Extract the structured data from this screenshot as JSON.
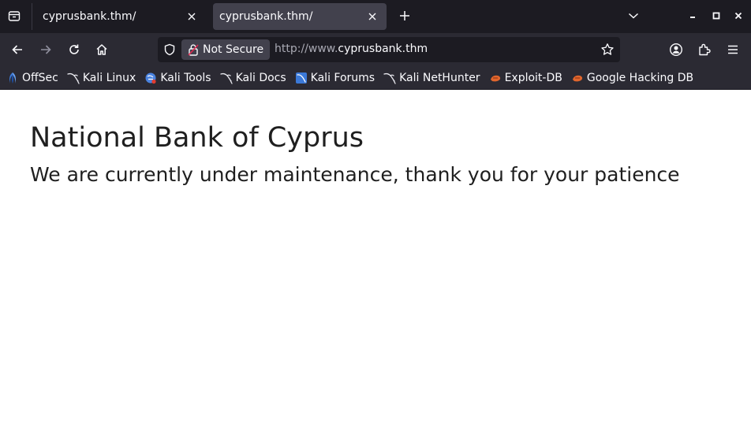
{
  "tabs": [
    {
      "title": "cyprusbank.thm/",
      "active": false
    },
    {
      "title": "cyprusbank.thm/",
      "active": true
    }
  ],
  "urlbar": {
    "security_label": "Not Secure",
    "url_prefix": "http://www.",
    "url_host": "cyprusbank.thm"
  },
  "bookmarks": [
    {
      "label": "OffSec",
      "icon": "offsec-icon"
    },
    {
      "label": "Kali Linux",
      "icon": "kali-dragon-icon"
    },
    {
      "label": "Kali Tools",
      "icon": "kali-tools-icon"
    },
    {
      "label": "Kali Docs",
      "icon": "kali-dragon-icon"
    },
    {
      "label": "Kali Forums",
      "icon": "kali-forums-icon"
    },
    {
      "label": "Kali NetHunter",
      "icon": "kali-dragon-icon"
    },
    {
      "label": "Exploit-DB",
      "icon": "exploit-db-icon"
    },
    {
      "label": "Google Hacking DB",
      "icon": "exploit-db-icon"
    }
  ],
  "page": {
    "heading": "National Bank of Cyprus",
    "message": "We are currently under maintenance, thank you for your patience"
  },
  "colors": {
    "tabstrip_bg": "#1c1b22",
    "toolbar_bg": "#2b2a33",
    "active_tab_bg": "#42414d",
    "page_bg": "#ffffff",
    "text_light": "#fbfbfe"
  }
}
